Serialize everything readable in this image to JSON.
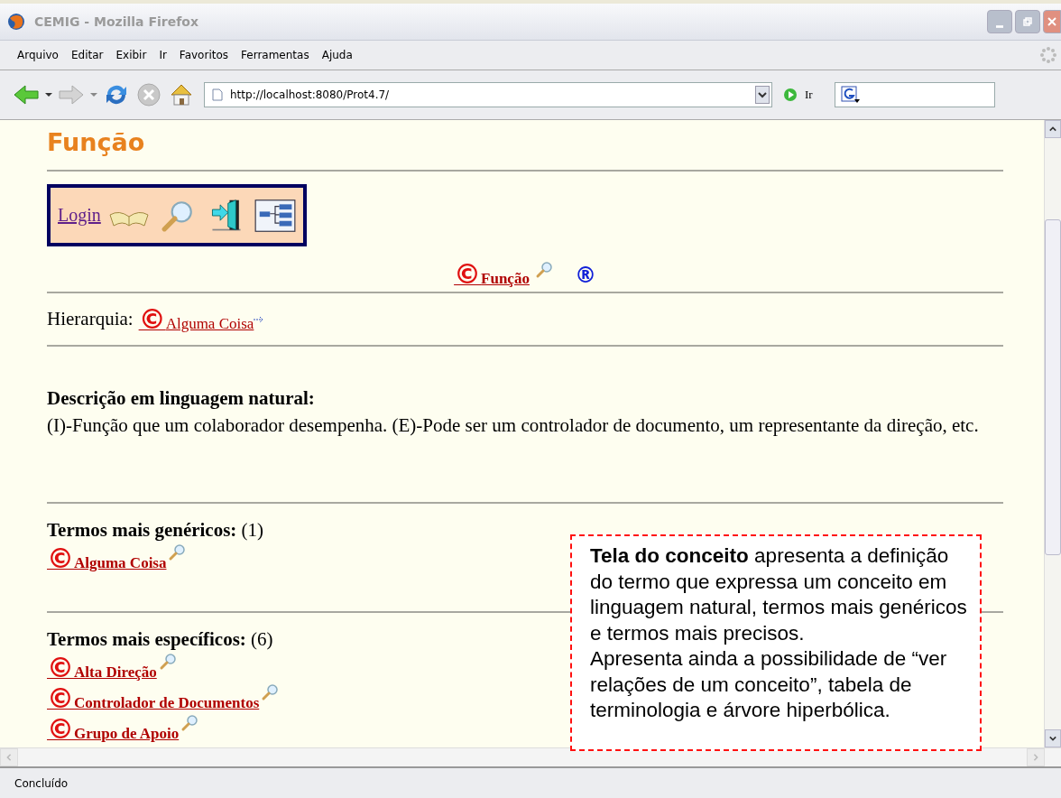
{
  "window": {
    "title": "CEMIG - Mozilla Firefox"
  },
  "menu": [
    "Arquivo",
    "Editar",
    "Exibir",
    "Ir",
    "Favoritos",
    "Ferramentas",
    "Ajuda"
  ],
  "toolbar": {
    "address": "http://localhost:8080/Prot4.7/",
    "go_label": "Ir"
  },
  "page": {
    "heading": "Função",
    "nav": {
      "login": "Login"
    },
    "concept": {
      "mark": "©",
      "name": "Função",
      "relation_mark": "®"
    },
    "hierarchy": {
      "label": "Hierarquia:",
      "mark": "©",
      "name": "Alguma Coisa"
    },
    "description": {
      "title": "Descrição em linguagem natural:",
      "text": "(I)-Função que um colaborador desempenha. (E)-Pode ser um controlador de documento, um representante da direção, etc."
    },
    "sections": [
      {
        "title": "Termos mais genéricos:",
        "count": "(1)",
        "terms": [
          {
            "mark": "©",
            "name": "Alguma Coisa"
          }
        ]
      },
      {
        "title": "Termos mais específicos:",
        "count": "(6)",
        "terms": [
          {
            "mark": "©",
            "name": "Alta Direção"
          },
          {
            "mark": "©",
            "name": "Controlador de Documentos"
          },
          {
            "mark": "©",
            "name": "Grupo de Apoio"
          }
        ]
      }
    ]
  },
  "callout": {
    "paragraphs": [
      "**Tela do conceito** apresenta a definição do termo que expressa um conceito em linguagem natural, termos mais genéricos e termos mais precisos.",
      "Apresenta ainda a possibilidade de “ver relações de um conceito”, tabela de terminologia e árvore hiperbólica."
    ]
  },
  "status_bar": "Concluído"
}
